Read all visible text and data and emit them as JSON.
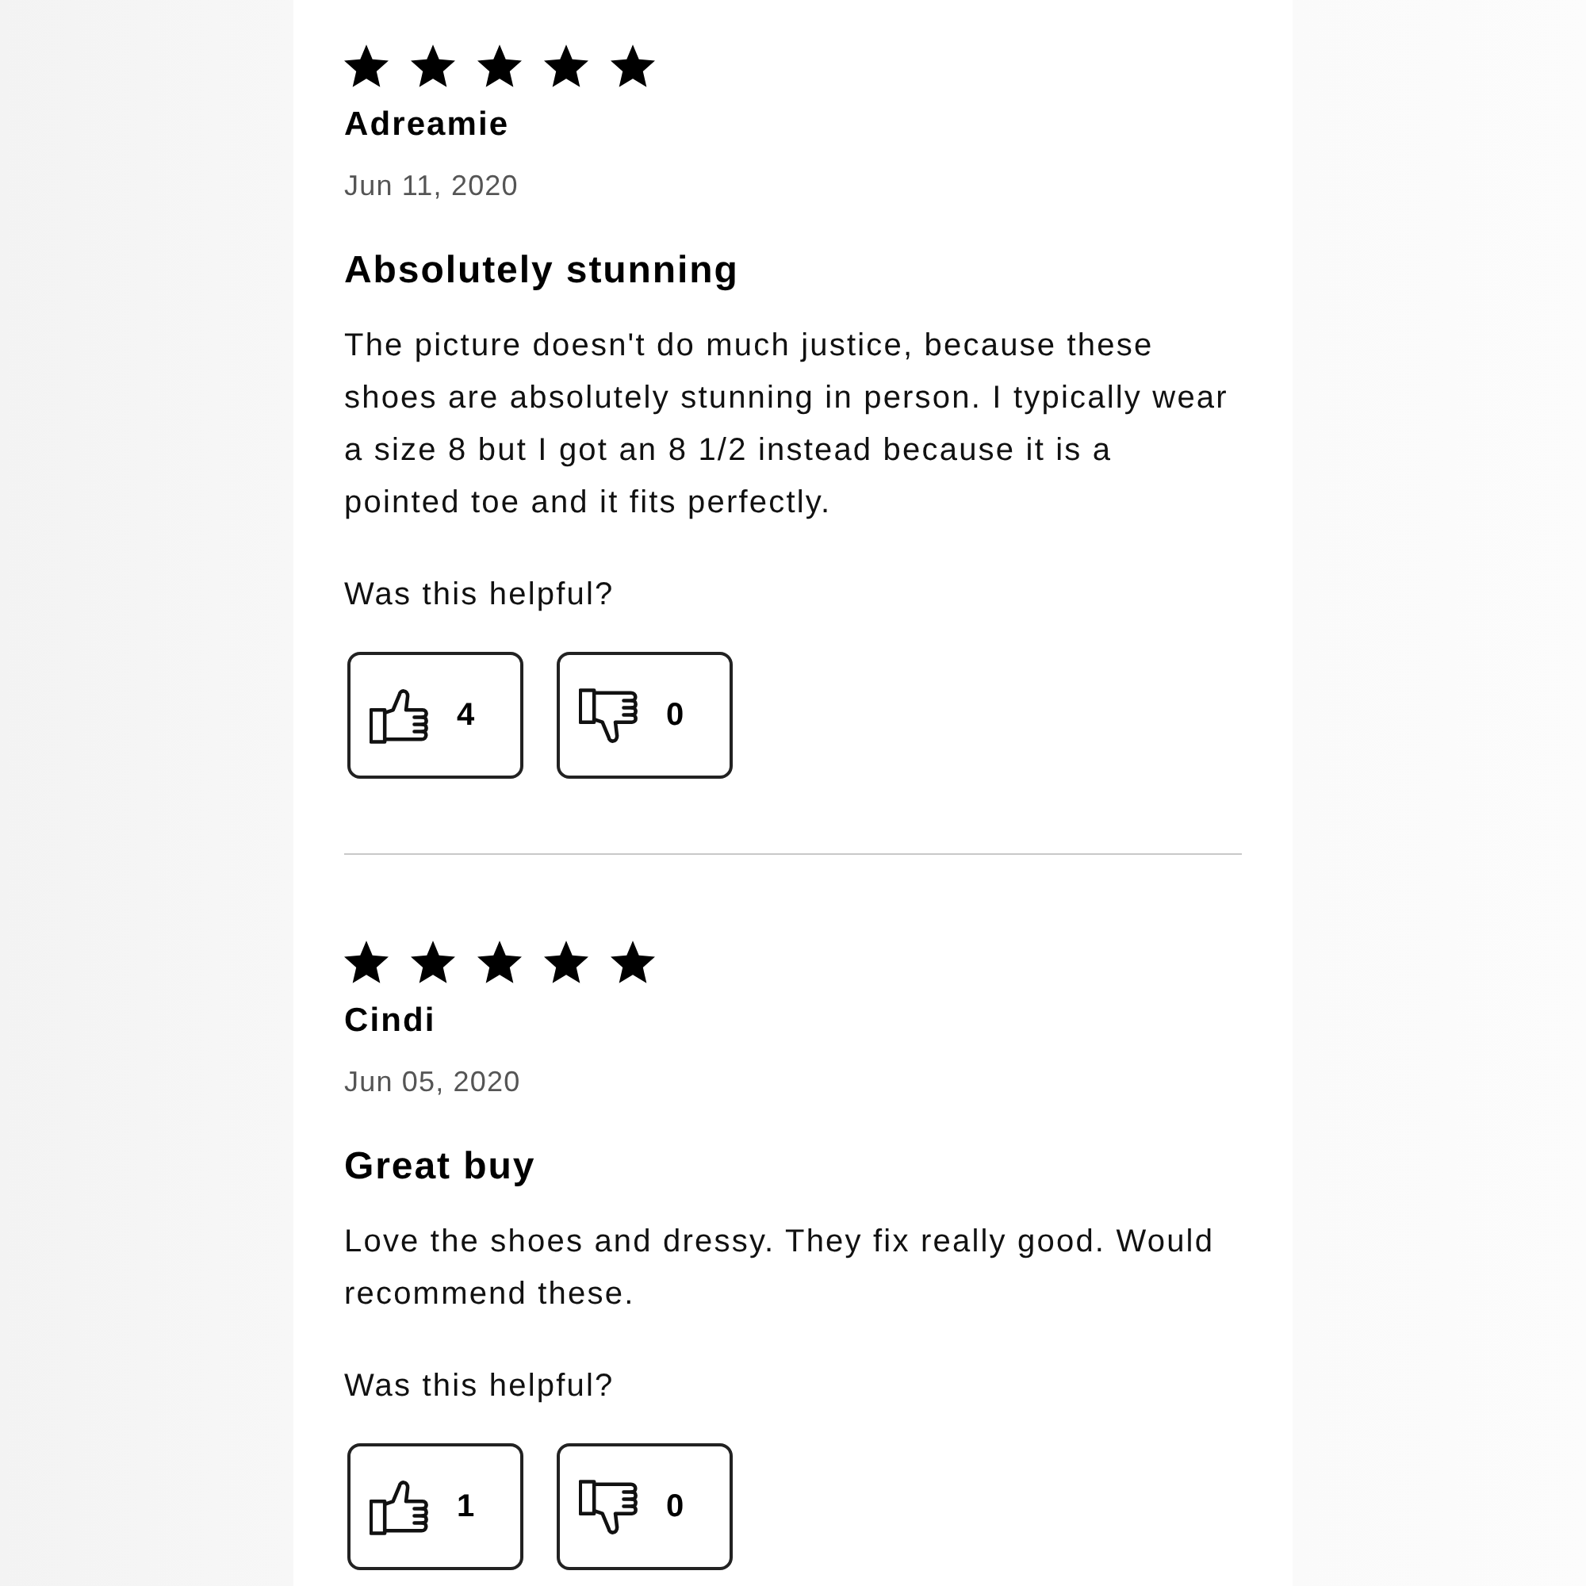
{
  "reviews": [
    {
      "stars": 5,
      "author": "Adreamie",
      "date": "Jun 11, 2020",
      "title": "Absolutely stunning",
      "body": "The picture doesn't do much justice, because these shoes are absolutely stunning in person. I typically wear a size 8 but I got an 8 1/2 instead because it is a pointed toe and it fits perfectly.",
      "helpful_prompt": "Was this helpful?",
      "votes": [
        {
          "kind": "up",
          "count": "4"
        },
        {
          "kind": "down",
          "count": "0"
        }
      ]
    },
    {
      "stars": 5,
      "author": "Cindi",
      "date": "Jun 05, 2020",
      "title": "Great buy",
      "body": "Love the shoes and dressy. They fix really good. Would recommend these.",
      "helpful_prompt": "Was this helpful?",
      "votes": [
        {
          "kind": "up",
          "count": "1"
        },
        {
          "kind": "down",
          "count": "0"
        }
      ]
    }
  ]
}
